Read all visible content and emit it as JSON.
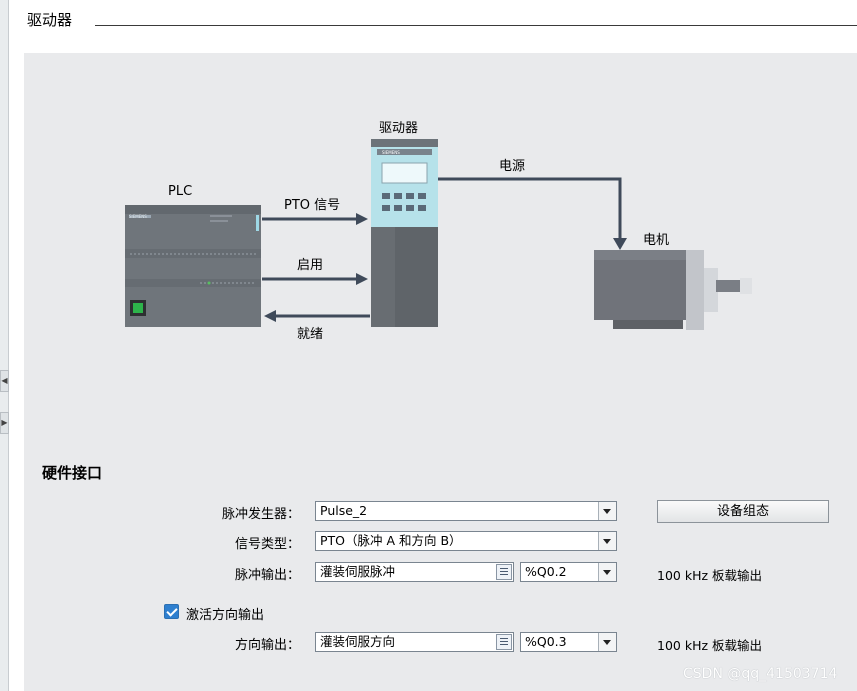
{
  "section": {
    "title": "驱动器"
  },
  "diagram": {
    "drive_label": "驱动器",
    "drive_brand": "SIEMENS",
    "plc_label": "PLC",
    "plc_brand": "SIEMENS",
    "signal_pto": "PTO 信号",
    "signal_enable": "启用",
    "signal_ready": "就绪",
    "power_label": "电源",
    "motor_label": "电机"
  },
  "hardware": {
    "title": "硬件接口",
    "pulse_generator": {
      "label": "脉冲发生器：",
      "value": "Pulse_2"
    },
    "config_button": "设备组态",
    "signal_type": {
      "label": "信号类型：",
      "value": "PTO（脉冲 A 和方向 B）"
    },
    "pulse_output": {
      "label": "脉冲输出：",
      "tag": "灌装伺服脉冲",
      "address": "%Q0.2",
      "note": "100 kHz 板载输出"
    },
    "enable_direction": {
      "label": "激活方向输出",
      "checked": true
    },
    "direction_output": {
      "label": "方向输出：",
      "tag": "灌装伺服方向",
      "address": "%Q0.3",
      "note": "100 kHz 板载输出"
    }
  },
  "watermark": "CSDN @qq_41503714",
  "colors": {
    "panel_bg": "#e9eaec",
    "plc_body": "#6f757b",
    "drive_teal": "#b6e2ea",
    "drive_dark": "#5f6469",
    "arrow": "#3f4a5a",
    "motor": "#70737a",
    "checkbox": "#2e7fcf"
  }
}
